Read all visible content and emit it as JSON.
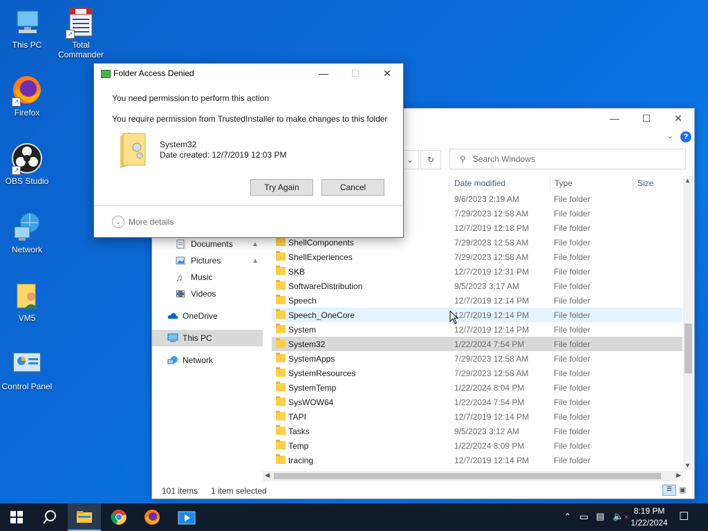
{
  "desktop": {
    "icons": [
      {
        "label": "This PC"
      },
      {
        "label": "Total Commander"
      },
      {
        "label": "Firefox"
      },
      {
        "label": "OBS Studio"
      },
      {
        "label": "Network"
      },
      {
        "label": "VM5"
      },
      {
        "label": "Control Panel"
      }
    ]
  },
  "explorer": {
    "search_placeholder": "Search Windows",
    "columns": {
      "date": "Date modified",
      "type": "Type",
      "size": "Size"
    },
    "nav": [
      {
        "label": "Documents",
        "pinned": true
      },
      {
        "label": "Pictures",
        "pinned": true
      },
      {
        "label": "Music"
      },
      {
        "label": "Videos"
      },
      {
        "label": "OneDrive"
      },
      {
        "label": "This PC"
      },
      {
        "label": "Network"
      }
    ],
    "rows": [
      {
        "name": "",
        "date": "9/6/2023 2:19 AM",
        "type": "File folder"
      },
      {
        "name": "",
        "date": "7/29/2023 12:58 AM",
        "type": "File folder"
      },
      {
        "name": "",
        "date": "12/7/2019 12:18 PM",
        "type": "File folder"
      },
      {
        "name": "ShellComponents",
        "date": "7/29/2023 12:58 AM",
        "type": "File folder"
      },
      {
        "name": "ShellExperiences",
        "date": "7/29/2023 12:58 AM",
        "type": "File folder"
      },
      {
        "name": "SKB",
        "date": "12/7/2019 12:31 PM",
        "type": "File folder"
      },
      {
        "name": "SoftwareDistribution",
        "date": "9/5/2023 3:17 AM",
        "type": "File folder"
      },
      {
        "name": "Speech",
        "date": "12/7/2019 12:14 PM",
        "type": "File folder"
      },
      {
        "name": "Speech_OneCore",
        "date": "12/7/2019 12:14 PM",
        "type": "File folder"
      },
      {
        "name": "System",
        "date": "12/7/2019 12:14 PM",
        "type": "File folder"
      },
      {
        "name": "System32",
        "date": "1/22/2024 7:54 PM",
        "type": "File folder"
      },
      {
        "name": "SystemApps",
        "date": "7/29/2023 12:58 AM",
        "type": "File folder"
      },
      {
        "name": "SystemResources",
        "date": "7/29/2023 12:58 AM",
        "type": "File folder"
      },
      {
        "name": "SystemTemp",
        "date": "1/22/2024 8:04 PM",
        "type": "File folder"
      },
      {
        "name": "SysWOW64",
        "date": "1/22/2024 7:54 PM",
        "type": "File folder"
      },
      {
        "name": "TAPI",
        "date": "12/7/2019 12:14 PM",
        "type": "File folder"
      },
      {
        "name": "Tasks",
        "date": "9/5/2023 3:12 AM",
        "type": "File folder"
      },
      {
        "name": "Temp",
        "date": "1/22/2024 8:09 PM",
        "type": "File folder"
      },
      {
        "name": "tracing",
        "date": "12/7/2019 12:14 PM",
        "type": "File folder"
      }
    ],
    "status": {
      "count": "101 items",
      "selected": "1 item selected"
    }
  },
  "dialog": {
    "title": "Folder Access Denied",
    "line1": "You need permission to perform this action",
    "line2": "You require permission from TrustedInstaller to make changes to this folder",
    "folder_name": "System32",
    "date_created": "Date created: 12/7/2019 12:03 PM",
    "try_again": "Try Again",
    "cancel": "Cancel",
    "more_details": "More details"
  },
  "taskbar": {
    "time": "8:19 PM",
    "date": "1/22/2024"
  }
}
